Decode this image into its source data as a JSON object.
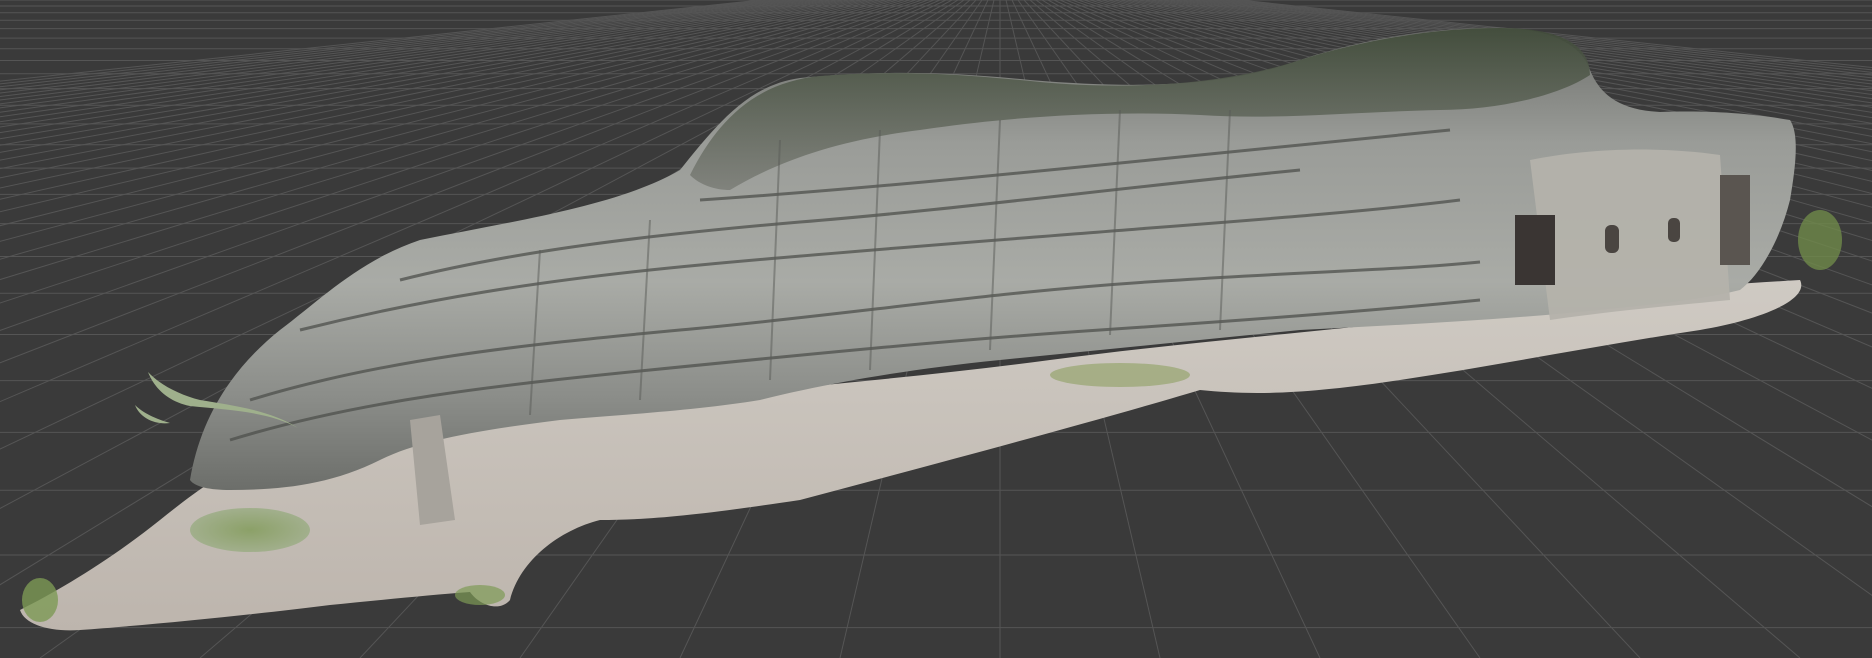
{
  "viewport": {
    "background_color": "#3a3a3a",
    "grid_line_color": "#555555",
    "grid_axis_line_color": "#5c5c5c"
  },
  "model": {
    "name_icon": "photogrammetry-mesh",
    "rock_face_color": "#8a8c8a",
    "rock_highlight_color": "#b5b7b3",
    "rock_shadow_color": "#4a4c4a",
    "ground_color": "#c9c3bc",
    "vegetation_color": "#6f8a4a",
    "doorway_color": "#3a3533"
  }
}
